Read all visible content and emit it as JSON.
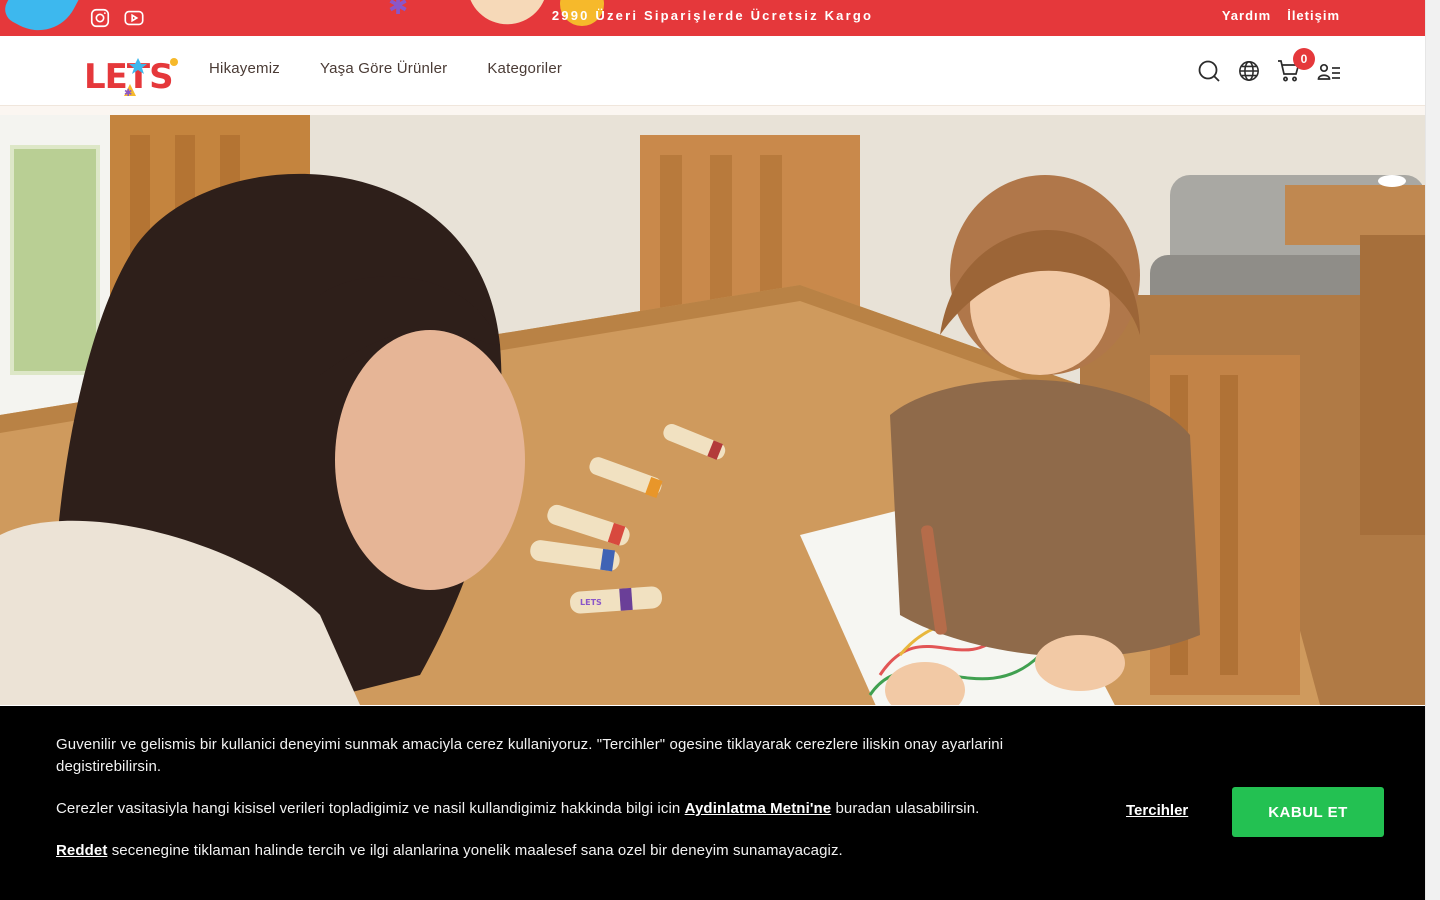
{
  "topbar": {
    "promo": "2990 Üzeri Siparişlerde Ücretsiz Kargo",
    "links": [
      "Yardım",
      "İletişim"
    ],
    "background": "#e5383b"
  },
  "header": {
    "logo_text": "LETS",
    "nav": [
      "Hikayemiz",
      "Yaşa Göre Ürünler",
      "Kategoriler"
    ],
    "cart_count": "0",
    "icons": [
      "search-icon",
      "globe-icon",
      "cart-icon",
      "user-menu-icon"
    ]
  },
  "social": [
    "instagram-icon",
    "youtube-icon"
  ],
  "cookie": {
    "line1": "Guvenilir ve gelismis bir kullanici deneyimi sunmak amaciyla cerez kullaniyoruz. \"Tercihler\" ogesine tiklayarak cerezlere iliskin onay ayarlarini degistirebilirsin.",
    "line2_pre": "Cerezler vasitasiyla hangi kisisel verileri topladigimiz ve nasil kullandigimiz hakkinda bilgi icin ",
    "line2_link": "Aydinlatma Metni'ne",
    "line2_post": " buradan ulasabilirsin.",
    "line3_link": "Reddet",
    "line3_post": " secenegine tiklaman halinde tercih ve ilgi alanlarina yonelik maalesef sana ozel bir deneyim sunamayacagiz.",
    "preferences_label": "Tercihler",
    "accept_label": "KABUL ET",
    "accept_color": "#23c152"
  },
  "hero": {
    "crayon_brand": "LETS"
  }
}
